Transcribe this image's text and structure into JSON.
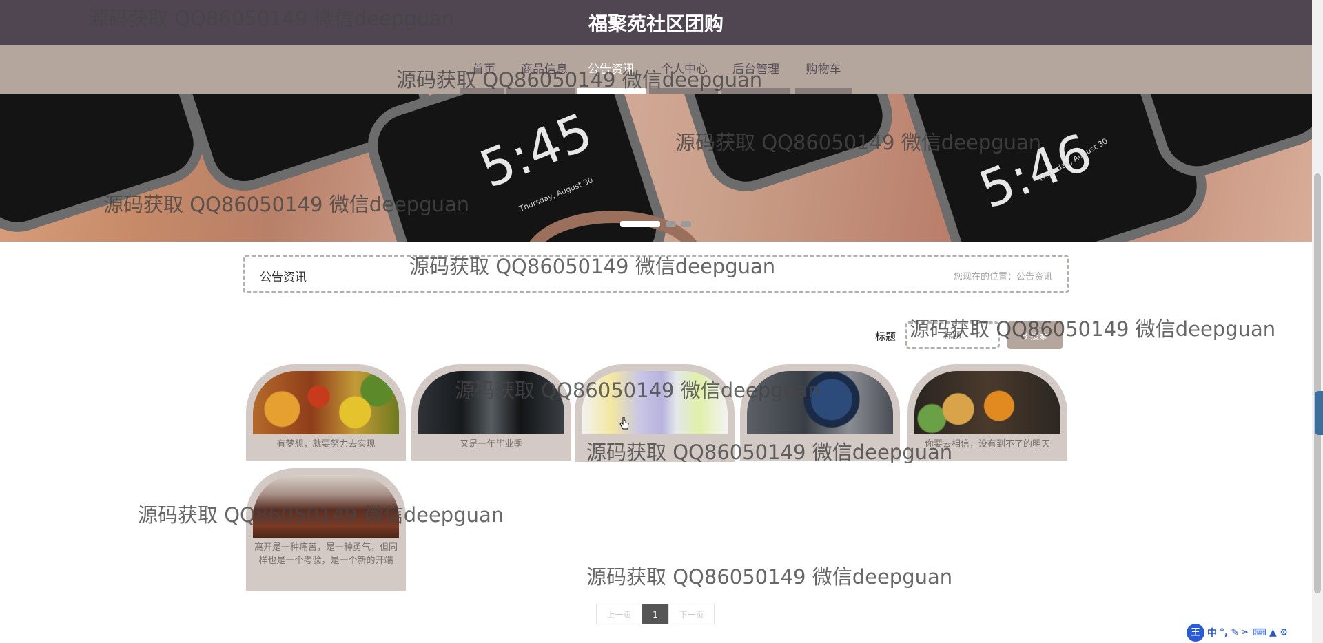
{
  "header": {
    "title": "福聚苑社区团购"
  },
  "nav": {
    "items": [
      {
        "label": "首页",
        "active": false
      },
      {
        "label": "商品信息",
        "active": false
      },
      {
        "label": "公告资讯",
        "active": true
      },
      {
        "label": "个人中心",
        "active": false
      },
      {
        "label": "后台管理",
        "active": false
      },
      {
        "label": "购物车",
        "active": false
      }
    ]
  },
  "banner": {
    "clock_left": "5:45",
    "date_left": "Thursday, August 30",
    "clock_right": "5:46",
    "date_right": "Thursday, August 30",
    "active_slide": 1,
    "slide_count": 3
  },
  "breadcrumb": {
    "section_title": "公告资讯",
    "location": "您现在的位置：公告资讯"
  },
  "search": {
    "label": "标题",
    "placeholder": "标题",
    "button_label": "搜索",
    "icon": "search-icon"
  },
  "news": [
    {
      "title": "有梦想，就要努力去实现",
      "image": "fruit-image"
    },
    {
      "title": "又是一年毕业季",
      "image": "oven-image"
    },
    {
      "title": "",
      "image": "phones-image"
    },
    {
      "title": "",
      "image": "watch-image"
    },
    {
      "title": "你要去相信，没有到不了的明天",
      "image": "drinks-image"
    },
    {
      "title": "离开是一种痛苦，是一种勇气，但同样也是一个考验，是一个新的开端",
      "image": "living-room-image"
    }
  ],
  "pagination": {
    "prev_label": "上一页",
    "current_page": "1",
    "next_label": "下一页"
  },
  "watermark": {
    "text": "源码获取 QQ86050149 微信deepguan"
  },
  "ime": {
    "logo": "王",
    "mode": "中",
    "icons": [
      "punctuation-icon",
      "pen-icon",
      "scissors-icon",
      "keyboard-icon",
      "shirt-icon",
      "settings-icon"
    ]
  },
  "colors": {
    "header_bg": "#4f4652",
    "nav_bg": "#b4a59d",
    "card_bg": "#d3cac5",
    "active_nav": "#ffffff"
  }
}
